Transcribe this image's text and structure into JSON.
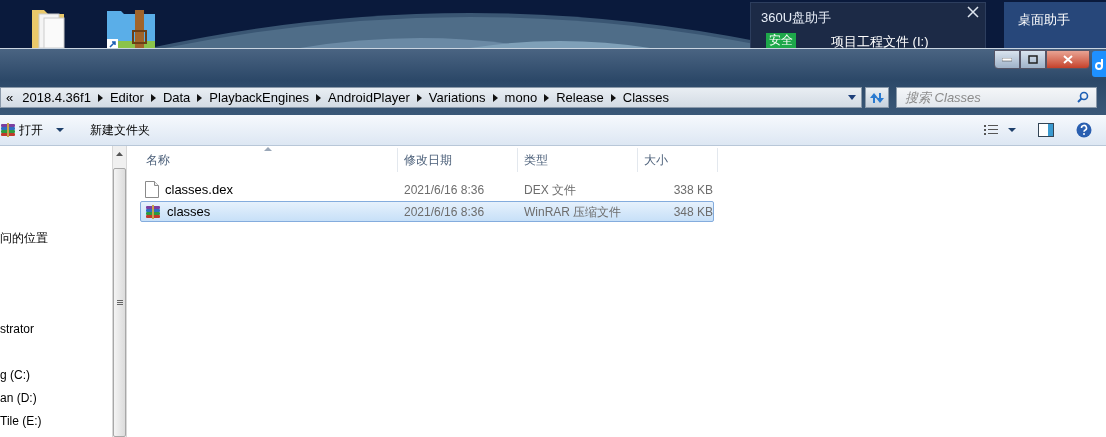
{
  "popup": {
    "title": "360U盘助手",
    "badge": "安全",
    "drive": "项目工程文件 (I:)"
  },
  "desktop_widget": {
    "title": "桌面助手"
  },
  "address_bar": {
    "overflow": "«",
    "crumbs": [
      "2018.4.36f1",
      "Editor",
      "Data",
      "PlaybackEngines",
      "AndroidPlayer",
      "Variations",
      "mono",
      "Release",
      "Classes"
    ]
  },
  "search": {
    "placeholder": "搜索 Classes"
  },
  "toolbar": {
    "open": "打开",
    "new_folder": "新建文件夹"
  },
  "nav_pane": {
    "items": [
      "问的位置",
      "strator",
      "g (C:)",
      "an (D:)",
      "Tile (E:)"
    ]
  },
  "columns": [
    "名称",
    "修改日期",
    "类型",
    "大小"
  ],
  "files": [
    {
      "kind": "dex",
      "name": "classes.dex",
      "date": "2021/6/16 8:36",
      "type": "DEX 文件",
      "size": "338 KB",
      "selected": false
    },
    {
      "kind": "rar",
      "name": "classes",
      "date": "2021/6/16 8:36",
      "type": "WinRAR 压缩文件",
      "size": "348 KB",
      "selected": true
    }
  ]
}
